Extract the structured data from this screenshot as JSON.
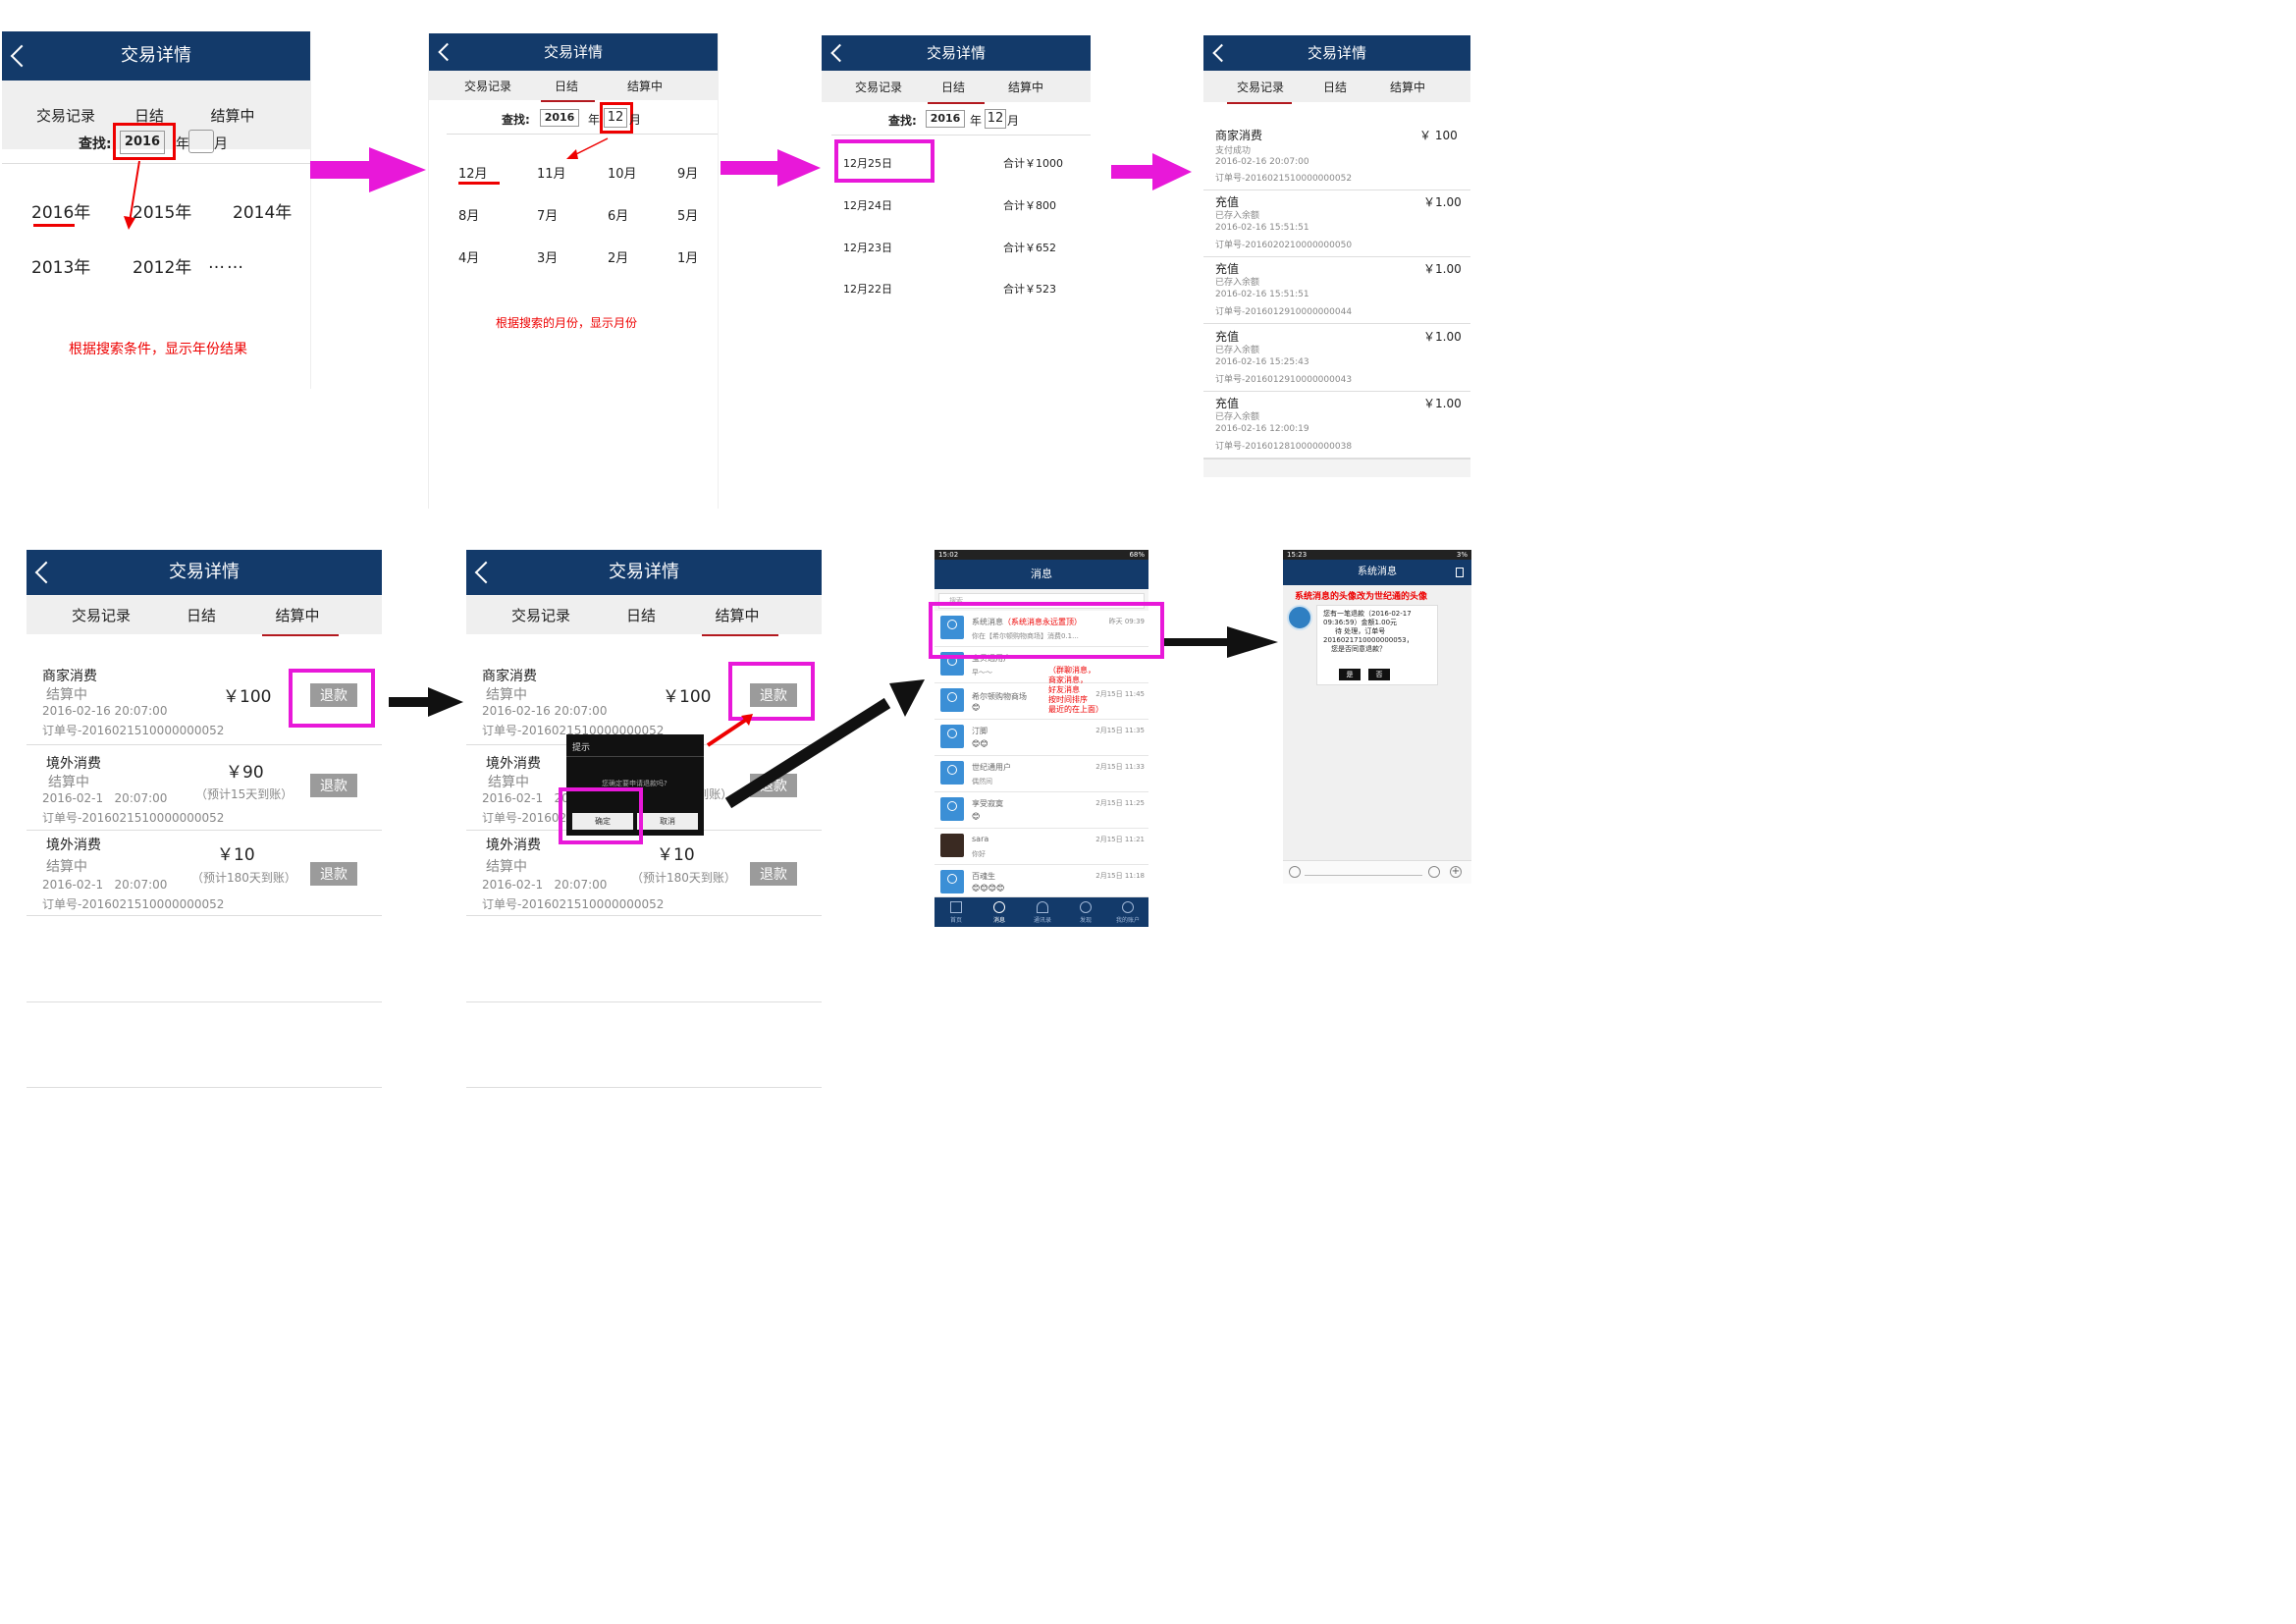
{
  "common": {
    "title": "交易详情",
    "tabs": [
      "交易记录",
      "日结",
      "结算中"
    ],
    "search_label": "查找:",
    "search_year": "2016",
    "year_suffix": "年",
    "month_suffix": "月",
    "month_value": "12"
  },
  "screen1": {
    "years": [
      "2016年",
      "2015年",
      "2014年",
      "2013年",
      "2012年",
      "……"
    ],
    "note": "根据搜索条件，显示年份结果"
  },
  "screen2": {
    "months": [
      "12月",
      "11月",
      "10月",
      "9月",
      "8月",
      "7月",
      "6月",
      "5月",
      "4月",
      "3月",
      "2月",
      "1月"
    ],
    "note": "根据搜索的月份，显示月份"
  },
  "screen3": {
    "days": [
      {
        "date": "12月25日",
        "total": "合计￥1000"
      },
      {
        "date": "12月24日",
        "total": "合计￥800"
      },
      {
        "date": "12月23日",
        "total": "合计￥652"
      },
      {
        "date": "12月22日",
        "total": "合计￥523"
      }
    ]
  },
  "screen4": {
    "records": [
      {
        "title": "商家消费",
        "amount": "￥ 100",
        "status": "支付成功",
        "time": "2016-02-16 20:07:00",
        "order": "订单号-2016021510000000052"
      },
      {
        "title": "充值",
        "amount": "￥1.00",
        "status": "已存入余额",
        "time": "2016-02-16 15:51:51",
        "order": "订单号-2016020210000000050"
      },
      {
        "title": "充值",
        "amount": "￥1.00",
        "status": "已存入余额",
        "time": "2016-02-16 15:51:51",
        "order": "订单号-2016012910000000044"
      },
      {
        "title": "充值",
        "amount": "￥1.00",
        "status": "已存入余额",
        "time": "2016-02-16 15:25:43",
        "order": "订单号-2016012910000000043"
      },
      {
        "title": "充值",
        "amount": "￥1.00",
        "status": "已存入余额",
        "time": "2016-02-16 12:00:19",
        "order": "订单号-2016012810000000038"
      }
    ]
  },
  "settle": {
    "refund_label": "退款",
    "items": [
      {
        "title": "商家消费",
        "status": "结算中",
        "amount": "￥100",
        "time": "2016-02-16 20:07:00",
        "eta": "",
        "order": "订单号-2016021510000000052"
      },
      {
        "title": "境外消费",
        "status": "结算中",
        "amount": "￥90",
        "time": "2016-02-1   20:07:00",
        "eta": "（预计15天到账）",
        "order": "订单号-2016021510000000052"
      },
      {
        "title": "境外消费",
        "status": "结算中",
        "amount": "￥10",
        "time": "2016-02-1   20:07:00",
        "eta": "（预计180天到账）",
        "order": "订单号-2016021510000000052"
      }
    ]
  },
  "dialog": {
    "title": "提示",
    "message": "您确定要申请退款吗?",
    "ok": "确定",
    "cancel": "取消"
  },
  "messages": {
    "status_time": "15:02",
    "status_right": "68%",
    "header": "消息",
    "search_placeholder": "搜索",
    "annotation": [
      "（群聊消息，",
      "商家消息，",
      "好友消息",
      "按时间排序",
      "最近的在上面）"
    ],
    "rows": [
      {
        "name": "系统消息",
        "tag": "（系统消息永远置顶）",
        "time": "昨天 09:39",
        "preview": "你在【希尔顿购物商场】消费0.1..."
      },
      {
        "name": "宝贝通用户",
        "tag": "",
        "time": "",
        "preview": "早～～"
      },
      {
        "name": "希尔顿购物商场",
        "tag": "",
        "time": "2月15日 11:45",
        "preview": "😊"
      },
      {
        "name": "汀脚",
        "tag": "",
        "time": "2月15日 11:35",
        "preview": "😊😊"
      },
      {
        "name": "世纪通用户",
        "tag": "",
        "time": "2月15日 11:33",
        "preview": "偶然间"
      },
      {
        "name": "享受寂寞",
        "tag": "",
        "time": "2月15日 11:25",
        "preview": "😊"
      },
      {
        "name": "sara",
        "tag": "",
        "time": "2月15日 11:21",
        "preview": "你好"
      },
      {
        "name": "百魂生",
        "tag": "",
        "time": "2月15日 11:18",
        "preview": "😊😊😊😊"
      }
    ],
    "nav": [
      "首页",
      "消息",
      "通讯录",
      "发现",
      "我的账户"
    ]
  },
  "sysmsg": {
    "status_time": "15:23",
    "status_right": "3%",
    "header": "系统消息",
    "note": "系统消息的头像改为世纪通的头像",
    "bubble": [
      "您有一笔退款（2016-02-17",
      "09:36:59）金额1.00元",
      "待 处理，订单号",
      "2016021710000000053，",
      "您是否同意退款？"
    ],
    "yes": "是",
    "no": "否"
  },
  "colors": {
    "header": "#133a6a",
    "accent_red": "#b3191f",
    "highlight": "#e818d9",
    "refund_button": "#9b9b9b"
  }
}
